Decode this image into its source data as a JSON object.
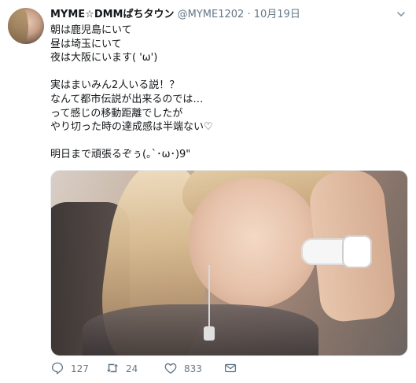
{
  "tweet": {
    "display_name": "MYME☆DMMぱちタウン",
    "handle": "@MYME1202",
    "separator": "·",
    "date": "10月19日",
    "lines": [
      "朝は鹿児島にいて",
      "昼は埼玉にいて",
      "夜は大阪にいます( 'ω')",
      "",
      "実はまいみん2人いる説！？",
      "なんて都市伝説が出来るのでは…",
      "って感じの移動距離でしたが",
      "やり切った時の達成感は半端ない♡",
      "",
      "明日まで頑張るぞぅ(｡`･ω･)9\""
    ],
    "actions": {
      "reply_count": "127",
      "retweet_count": "24",
      "like_count": "833"
    }
  },
  "icons": {
    "reply": "reply-icon",
    "retweet": "retweet-icon",
    "like": "heart-icon",
    "dm": "envelope-icon",
    "caret": "chevron-down-icon"
  },
  "colors": {
    "name": "#14171a",
    "meta": "#657786",
    "text": "#14171a"
  }
}
